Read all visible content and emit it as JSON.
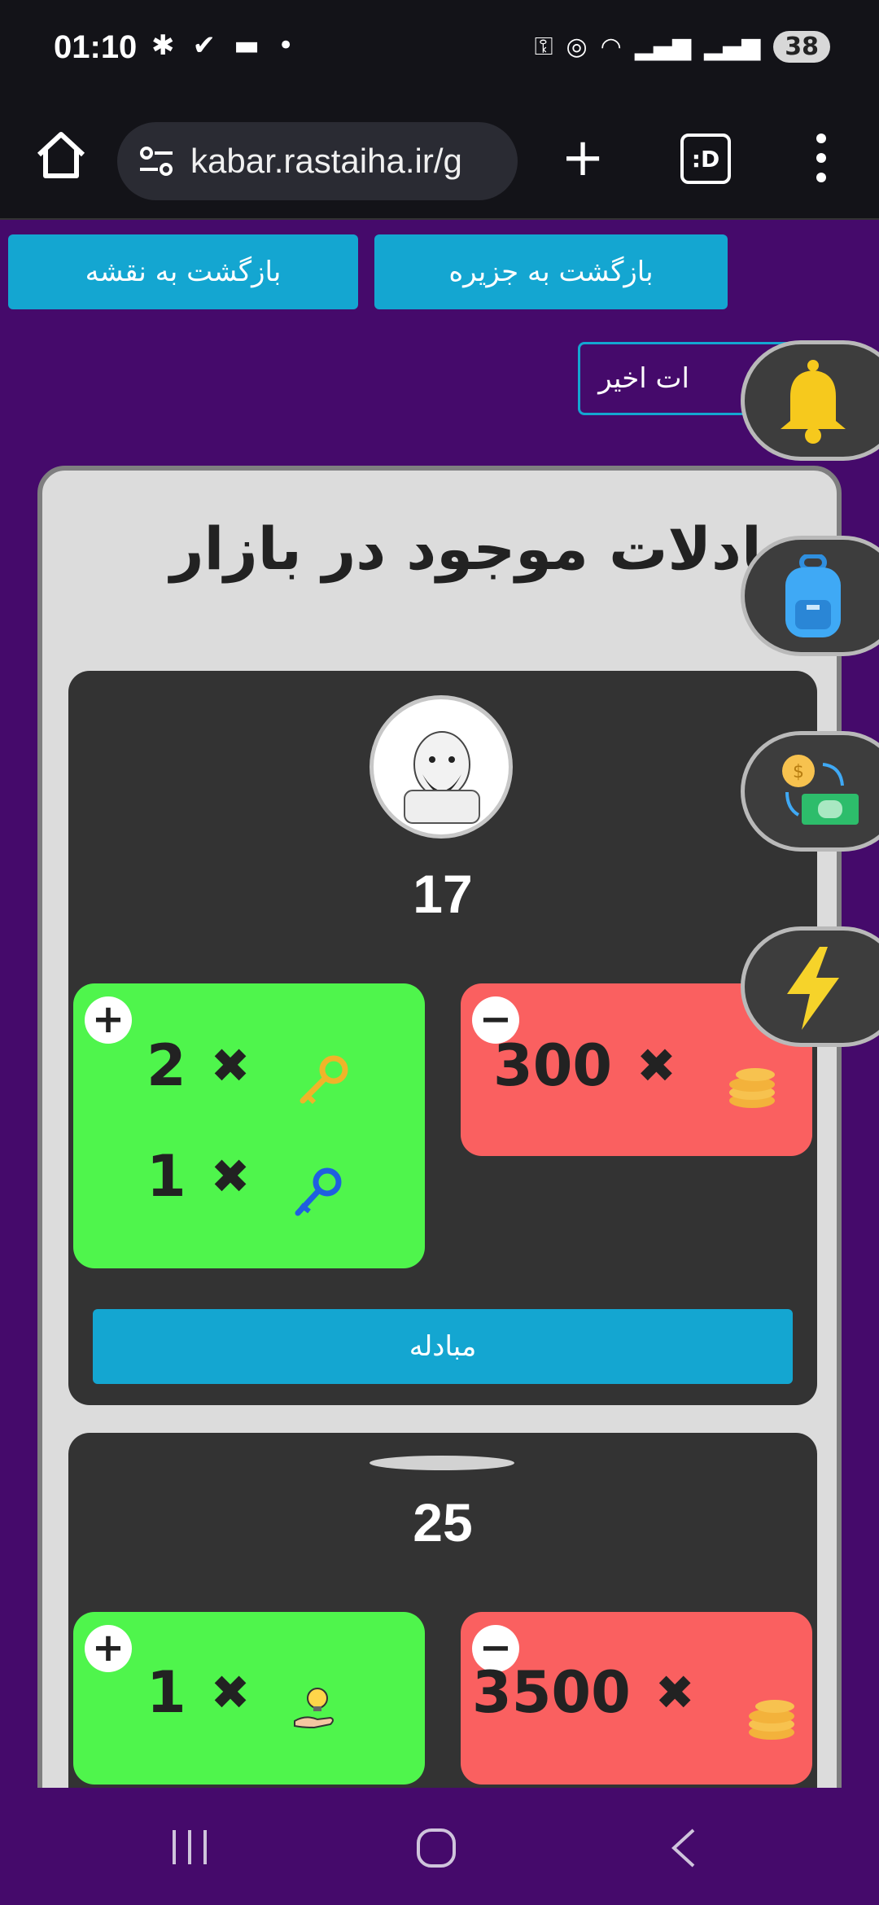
{
  "status": {
    "time": "01:10",
    "battery": "38"
  },
  "browser": {
    "url": "kabar.rastaiha.ir/g"
  },
  "nav": {
    "back_to_island": "بازگشت به جزیره",
    "back_to_map": "بازگشت به نقشه"
  },
  "recent_label": "ات اخیر",
  "market": {
    "title": "مبادلات موجود در بازار",
    "offers": [
      {
        "number": "17",
        "give": [
          {
            "qty": "2",
            "item": "gold-key"
          },
          {
            "qty": "1",
            "item": "blue-key"
          }
        ],
        "get": [
          {
            "qty": "300",
            "item": "coins"
          }
        ],
        "button": "مبادله"
      },
      {
        "number": "25",
        "give": [
          {
            "qty": "1",
            "item": "idea-hand"
          }
        ],
        "get": [
          {
            "qty": "3500",
            "item": "coins"
          }
        ]
      }
    ]
  },
  "side_buttons": [
    "bell",
    "backpack",
    "exchange",
    "lightning"
  ],
  "colors": {
    "page_bg": "#450a6b",
    "accent": "#14a6d1",
    "give_bg": "#4ff54c",
    "get_bg": "#fa6060",
    "card_bg": "#333333"
  }
}
